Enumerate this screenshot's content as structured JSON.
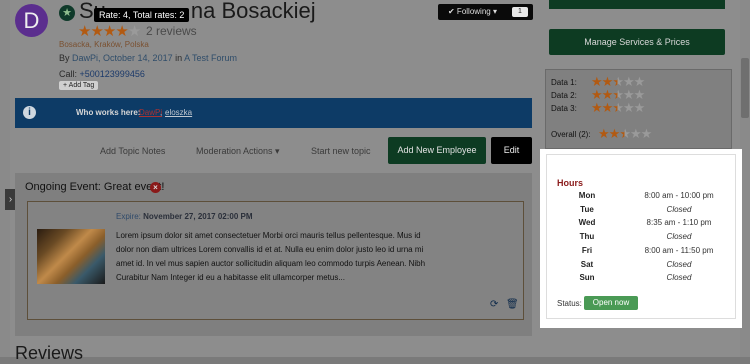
{
  "topic": {
    "avatar_letter": "D",
    "title": "Su",
    "title_rest": "na Bosackiej",
    "rating_tooltip": "Rate: 4, Total rates: 2",
    "rating_stars": 4,
    "rating_max": 5,
    "reviews_count": "2 reviews",
    "location": "Bosacka, Kraków, Polska",
    "by_prefix": "By ",
    "author": "DawPi",
    "date": ", October 14, 2017",
    "in_text": " in ",
    "forum": "A Test Forum",
    "call_label": "Call: ",
    "phone": "+500123999456",
    "add_tag": "+ Add Tag"
  },
  "follow": {
    "label": "✔ Following ▾",
    "count": "1"
  },
  "who": {
    "label": "Who works here:",
    "users": [
      "DawPi",
      "eloszka"
    ]
  },
  "actions": {
    "add_notes": "Add Topic Notes",
    "moderation": "Moderation Actions ▾",
    "start_topic": "Start new topic",
    "add_employee": "Add New Employee",
    "edit": "Edit"
  },
  "event": {
    "title": "Ongoing Event: Great event!",
    "expire_label": "Expire: ",
    "expire_date": "November 27, 2017 02:00 PM",
    "body": "Lorem ipsum dolor sit amet consectetuer Morbi orci mauris tellus pellentesque. Mus id dolor non diam ultrices Lorem convallis id et at. Nulla eu enim dolor justo leo id urna mi amet id. In vel mus sapien auctor sollicitudin aliquam leo commodo turpis Aenean. Nibh Curabitur Nam Integer id eu a habitasse elit ullamcorper metus..."
  },
  "reviews_heading": "Reviews",
  "sidebar": {
    "manage_button": "Manage Services & Prices",
    "ratings": [
      {
        "label": "Data 1:",
        "stars": 2.5
      },
      {
        "label": "Data 2:",
        "stars": 2.5
      },
      {
        "label": "Data 3:",
        "stars": 2.5
      },
      {
        "label": "Overall (2):",
        "stars": 2.5
      }
    ]
  },
  "hours": {
    "title": "Hours",
    "rows": [
      {
        "day": "Mon",
        "time": "8:00 am - 10:00 pm",
        "closed": false
      },
      {
        "day": "Tue",
        "time": "Closed",
        "closed": true
      },
      {
        "day": "Wed",
        "time": "8:35 am - 1:10 pm",
        "closed": false
      },
      {
        "day": "Thu",
        "time": "Closed",
        "closed": true
      },
      {
        "day": "Fri",
        "time": "8:00 am - 11:50 pm",
        "closed": false
      },
      {
        "day": "Sat",
        "time": "Closed",
        "closed": true
      },
      {
        "day": "Sun",
        "time": "Closed",
        "closed": true
      }
    ],
    "status_label": "Status:",
    "status": "Open now"
  },
  "colors": {
    "primary_green": "#0d3b22",
    "info_blue": "#0d3b66",
    "star": "#b25a12",
    "open_badge": "#4a9a55"
  }
}
